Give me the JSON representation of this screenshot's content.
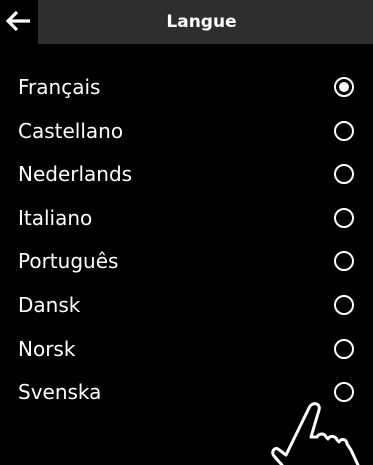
{
  "header": {
    "title": "Langue",
    "back_icon": "arrow-left-icon"
  },
  "languages": [
    {
      "label": "Français",
      "selected": true
    },
    {
      "label": "Castellano",
      "selected": false
    },
    {
      "label": "Nederlands",
      "selected": false
    },
    {
      "label": "Italiano",
      "selected": false
    },
    {
      "label": "Português",
      "selected": false
    },
    {
      "label": "Dansk",
      "selected": false
    },
    {
      "label": "Norsk",
      "selected": false
    },
    {
      "label": "Svenska",
      "selected": false
    }
  ],
  "colors": {
    "background": "#000000",
    "header": "#2e2e2e",
    "text": "#ffffff"
  },
  "overlay_icon": "pointing-hand-icon"
}
